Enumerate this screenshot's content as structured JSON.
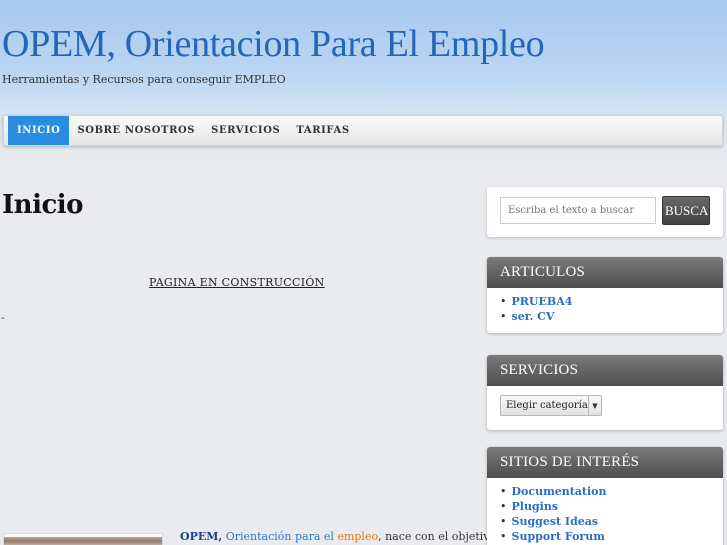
{
  "site": {
    "title": "OPEM, Orientacion Para El Empleo",
    "tagline": "Herramientas y Recursos para conseguir EMPLEO"
  },
  "nav": {
    "items": [
      {
        "label": "INICIO",
        "active": true
      },
      {
        "label": "SOBRE NOSOTROS",
        "active": false
      },
      {
        "label": "SERVICIOS",
        "active": false
      },
      {
        "label": "TARIFAS",
        "active": false
      }
    ]
  },
  "main": {
    "page_title": "Inicio",
    "construction_text": "PAGINA EN CONSTRUCCIÓN",
    "dash": "-",
    "intro": {
      "brand": "OPEM,",
      "link_part1": "Orientación para el",
      "link_part2": "empleo",
      "rest": ", nace con el objetivo"
    }
  },
  "sidebar": {
    "search": {
      "placeholder": "Escriba el texto a buscar",
      "button_label": "BUSCAR"
    },
    "articulos": {
      "title": "ARTICULOS",
      "items": [
        "PRUEBA4",
        "ser. CV"
      ]
    },
    "servicios": {
      "title": "SERVICIOS",
      "select_value": "Elegir categoría"
    },
    "sitios": {
      "title": "SITIOS DE INTERÉS",
      "items": [
        "Documentation",
        "Plugins",
        "Suggest Ideas",
        "Support Forum"
      ]
    }
  },
  "colors": {
    "title_blue": "#2566b6",
    "nav_active": "#2a8ce0",
    "link_blue": "#2a6ec3",
    "link_orange": "#e07b17",
    "widget_head": "#5e5e5e"
  }
}
